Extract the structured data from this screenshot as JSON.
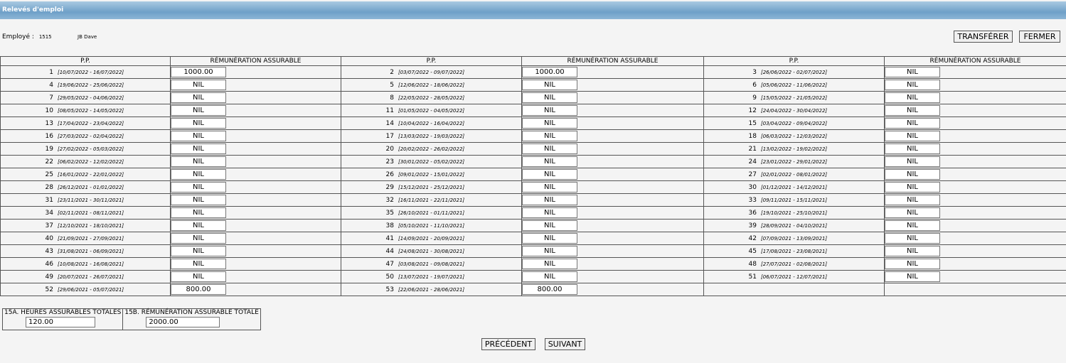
{
  "window": {
    "title": "Relevés d'emploi"
  },
  "employee": {
    "label": "Employé :",
    "code": "1515",
    "name": "JB Dave"
  },
  "buttons": {
    "transfer": "TRANSFÉRER",
    "close": "FERMER",
    "previous": "PRÉCÉDENT",
    "next": "SUIVANT"
  },
  "table": {
    "headers": [
      "P.P.",
      "RÉMUNÉRATION ASSURABLE",
      "P.P.",
      "RÉMUNÉRATION ASSURABLE",
      "P.P.",
      "RÉMUNÉRATION ASSURABLE"
    ],
    "rows": [
      [
        {
          "n": "1",
          "d": "[10/07/2022 - 16/07/2022]",
          "v": "1000.00"
        },
        {
          "n": "2",
          "d": "[03/07/2022 - 09/07/2022]",
          "v": "1000.00"
        },
        {
          "n": "3",
          "d": "[26/06/2022 - 02/07/2022]",
          "v": "NIL"
        }
      ],
      [
        {
          "n": "4",
          "d": "[19/06/2022 - 25/06/2022]",
          "v": "NIL"
        },
        {
          "n": "5",
          "d": "[12/06/2022 - 18/06/2022]",
          "v": "NIL"
        },
        {
          "n": "6",
          "d": "[05/06/2022 - 11/06/2022]",
          "v": "NIL"
        }
      ],
      [
        {
          "n": "7",
          "d": "[29/05/2022 - 04/06/2022]",
          "v": "NIL"
        },
        {
          "n": "8",
          "d": "[22/05/2022 - 28/05/2022]",
          "v": "NIL"
        },
        {
          "n": "9",
          "d": "[15/05/2022 - 21/05/2022]",
          "v": "NIL"
        }
      ],
      [
        {
          "n": "10",
          "d": "[08/05/2022 - 14/05/2022]",
          "v": "NIL"
        },
        {
          "n": "11",
          "d": "[01/05/2022 - 04/05/2022]",
          "v": "NIL"
        },
        {
          "n": "12",
          "d": "[24/04/2022 - 30/04/2022]",
          "v": "NIL"
        }
      ],
      [
        {
          "n": "13",
          "d": "[17/04/2022 - 23/04/2022]",
          "v": "NIL"
        },
        {
          "n": "14",
          "d": "[10/04/2022 - 16/04/2022]",
          "v": "NIL"
        },
        {
          "n": "15",
          "d": "[03/04/2022 - 09/04/2022]",
          "v": "NIL"
        }
      ],
      [
        {
          "n": "16",
          "d": "[27/03/2022 - 02/04/2022]",
          "v": "NIL"
        },
        {
          "n": "17",
          "d": "[13/03/2022 - 19/03/2022]",
          "v": "NIL"
        },
        {
          "n": "18",
          "d": "[06/03/2022 - 12/03/2022]",
          "v": "NIL"
        }
      ],
      [
        {
          "n": "19",
          "d": "[27/02/2022 - 05/03/2022]",
          "v": "NIL"
        },
        {
          "n": "20",
          "d": "[20/02/2022 - 26/02/2022]",
          "v": "NIL"
        },
        {
          "n": "21",
          "d": "[13/02/2022 - 19/02/2022]",
          "v": "NIL"
        }
      ],
      [
        {
          "n": "22",
          "d": "[06/02/2022 - 12/02/2022]",
          "v": "NIL"
        },
        {
          "n": "23",
          "d": "[30/01/2022 - 05/02/2022]",
          "v": "NIL"
        },
        {
          "n": "24",
          "d": "[23/01/2022 - 29/01/2022]",
          "v": "NIL"
        }
      ],
      [
        {
          "n": "25",
          "d": "[16/01/2022 - 22/01/2022]",
          "v": "NIL"
        },
        {
          "n": "26",
          "d": "[09/01/2022 - 15/01/2022]",
          "v": "NIL"
        },
        {
          "n": "27",
          "d": "[02/01/2022 - 08/01/2022]",
          "v": "NIL"
        }
      ],
      [
        {
          "n": "28",
          "d": "[26/12/2021 - 01/01/2022]",
          "v": "NIL"
        },
        {
          "n": "29",
          "d": "[15/12/2021 - 25/12/2021]",
          "v": "NIL"
        },
        {
          "n": "30",
          "d": "[01/12/2021 - 14/12/2021]",
          "v": "NIL"
        }
      ],
      [
        {
          "n": "31",
          "d": "[23/11/2021 - 30/11/2021]",
          "v": "NIL"
        },
        {
          "n": "32",
          "d": "[16/11/2021 - 22/11/2021]",
          "v": "NIL"
        },
        {
          "n": "33",
          "d": "[09/11/2021 - 15/11/2021]",
          "v": "NIL"
        }
      ],
      [
        {
          "n": "34",
          "d": "[02/11/2021 - 08/11/2021]",
          "v": "NIL"
        },
        {
          "n": "35",
          "d": "[26/10/2021 - 01/11/2021]",
          "v": "NIL"
        },
        {
          "n": "36",
          "d": "[19/10/2021 - 25/10/2021]",
          "v": "NIL"
        }
      ],
      [
        {
          "n": "37",
          "d": "[12/10/2021 - 18/10/2021]",
          "v": "NIL"
        },
        {
          "n": "38",
          "d": "[05/10/2021 - 11/10/2021]",
          "v": "NIL"
        },
        {
          "n": "39",
          "d": "[28/09/2021 - 04/10/2021]",
          "v": "NIL"
        }
      ],
      [
        {
          "n": "40",
          "d": "[21/09/2021 - 27/09/2021]",
          "v": "NIL"
        },
        {
          "n": "41",
          "d": "[14/09/2021 - 20/09/2021]",
          "v": "NIL"
        },
        {
          "n": "42",
          "d": "[07/09/2021 - 13/09/2021]",
          "v": "NIL"
        }
      ],
      [
        {
          "n": "43",
          "d": "[31/08/2021 - 06/09/2021]",
          "v": "NIL"
        },
        {
          "n": "44",
          "d": "[24/08/2021 - 30/08/2021]",
          "v": "NIL"
        },
        {
          "n": "45",
          "d": "[17/08/2021 - 23/08/2021]",
          "v": "NIL"
        }
      ],
      [
        {
          "n": "46",
          "d": "[10/08/2021 - 16/08/2021]",
          "v": "NIL"
        },
        {
          "n": "47",
          "d": "[03/08/2021 - 09/08/2021]",
          "v": "NIL"
        },
        {
          "n": "48",
          "d": "[27/07/2021 - 02/08/2021]",
          "v": "NIL"
        }
      ],
      [
        {
          "n": "49",
          "d": "[20/07/2021 - 26/07/2021]",
          "v": "NIL"
        },
        {
          "n": "50",
          "d": "[13/07/2021 - 19/07/2021]",
          "v": "NIL"
        },
        {
          "n": "51",
          "d": "[06/07/2021 - 12/07/2021]",
          "v": "NIL"
        }
      ],
      [
        {
          "n": "52",
          "d": "[29/06/2021 - 05/07/2021]",
          "v": "800.00"
        },
        {
          "n": "53",
          "d": "[22/06/2021 - 28/06/2021]",
          "v": "800.00"
        },
        null
      ]
    ]
  },
  "totals": {
    "hours_label": "15A. HEURES ASSURABLES TOTALES",
    "hours_value": "120.00",
    "earnings_label": "15B. RÉMUNÉRATION ASSURABLE TOTALE",
    "earnings_value": "2000.00"
  }
}
